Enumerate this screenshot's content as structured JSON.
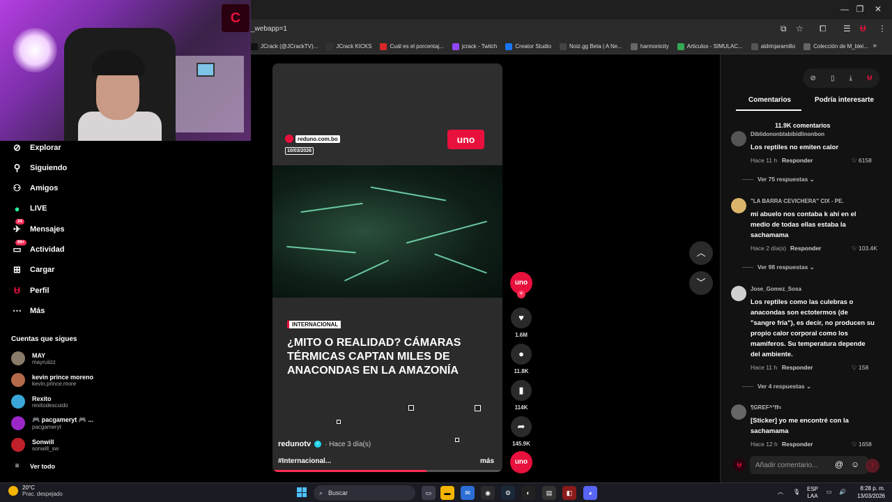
{
  "browser": {
    "url": "_webapp=1",
    "bookmarks": [
      {
        "label": "JCrack (@JCrackTV)...",
        "icon": "x-logo",
        "color": "#111111"
      },
      {
        "label": "JCrack KICKS",
        "icon": "j-logo",
        "color": "#333333"
      },
      {
        "label": "Cuál es el porcentaj...",
        "icon": "s-logo",
        "color": "#d62828"
      },
      {
        "label": "jcrack - Twitch",
        "icon": "twitch-logo",
        "color": "#9146ff"
      },
      {
        "label": "Creator Studio",
        "icon": "facebook-logo",
        "color": "#1877f2"
      },
      {
        "label": "Noiz.gg Beta | A Ne...",
        "icon": "noiz-logo",
        "color": "#444444"
      },
      {
        "label": "harmonicity",
        "icon": "harmonicity-logo",
        "color": "#666666"
      },
      {
        "label": "Articulos - SIMULAC...",
        "icon": "drive-logo",
        "color": "#34a853"
      },
      {
        "label": "aldrinjaramillo",
        "icon": "user-logo",
        "color": "#555555"
      },
      {
        "label": "Colección de M_blei...",
        "icon": "doc-logo",
        "color": "#666666"
      }
    ]
  },
  "webcam": {
    "logo_text": "C"
  },
  "sidebar": {
    "items": [
      {
        "label": "Explorar",
        "icon": "compass-icon"
      },
      {
        "label": "Siguiendo",
        "icon": "following-icon"
      },
      {
        "label": "Amigos",
        "icon": "friends-icon"
      },
      {
        "label": "LIVE",
        "icon": "live-icon"
      },
      {
        "label": "Mensajes",
        "icon": "messages-icon",
        "badge": "24"
      },
      {
        "label": "Actividad",
        "icon": "activity-icon",
        "badge": "99+"
      },
      {
        "label": "Cargar",
        "icon": "upload-icon"
      },
      {
        "label": "Perfil",
        "icon": "profile-icon"
      },
      {
        "label": "Más",
        "icon": "more-icon"
      }
    ],
    "following_title": "Cuentas que sigues",
    "accounts": [
      {
        "name": "MAY",
        "handle": "mayruiizz",
        "color": "#8a7a6a"
      },
      {
        "name": "kevin prince moreno",
        "handle": "kevin.prince.more",
        "color": "#b56a4a"
      },
      {
        "name": "Rexito",
        "handle": "rexitodescuido",
        "color": "#3aa7d8"
      },
      {
        "name": "🎮 pacgameryt 🎮 ...",
        "handle": "pacgameryt",
        "color": "#9b27c8"
      },
      {
        "name": "Sonwill",
        "handle": "sonwill_sw",
        "color": "#c0202a"
      }
    ],
    "see_all": "Ver todo"
  },
  "video": {
    "source_site": "reduno.com.bo",
    "date": "10/03/2026",
    "brand": "uno",
    "brand_small": "red",
    "tag": "INTERNACIONAL",
    "headline": "¿MITO O REALIDAD? CÁMARAS TÉRMICAS CAPTAN MILES DE ANACONDAS EN LA AMAZONÍA",
    "author": "redunotv",
    "time": "· Hace 3 día(s)",
    "description": "#Internacional...",
    "more_label": "más",
    "progress": 0.67
  },
  "actions": {
    "avatar_text": "uno",
    "likes": "1.6M",
    "comments": "11.8K",
    "saves": "114K",
    "shares": "145.9K"
  },
  "panel": {
    "tabs": [
      "Comentarios",
      "Podría interesarte"
    ],
    "comment_count": "11.9K comentarios",
    "comments": [
      {
        "user": "Diblidononblabibidlinonbon",
        "text": "Los reptiles no emiten calor",
        "time": "Hace 11 h",
        "reply": "Responder",
        "likes": "6158",
        "replies": "Ver 75 respuestas",
        "avatar_color": "#555555"
      },
      {
        "user": "\"LA BARRA CEVICHERA\" CIX - PE.",
        "text": "mi abuelo nos contaba k ahí en el medio de todas ellas estaba la sachamama",
        "time": "Hace 2 día(s)",
        "reply": "Responder",
        "likes": "103.4K",
        "replies": "Ver 98 respuestas",
        "avatar_color": "#d9b46a"
      },
      {
        "user": "Jose_Gomez_Sosa",
        "text": "Los reptiles como las culebras o anacondas son ectotermos (de \"sangre fría\"), es decir, no producen su propio calor corporal como los mamíferos. Su temperatura depende del ambiente.",
        "time": "Hace 11 h",
        "reply": "Responder",
        "likes": "158",
        "replies": "Ver 4 respuestas",
        "avatar_color": "#cfcfcf"
      },
      {
        "user": "¶GREF^°ff≈",
        "text": "[Sticker] yo me encontré con la sachamama",
        "time": "Hace 12 h",
        "reply": "Responder",
        "likes": "1658",
        "replies": "",
        "avatar_color": "#666666"
      }
    ],
    "input_placeholder": "Añadir comentario..."
  },
  "taskbar": {
    "temperature": "20°C",
    "weather": "Prac. despejado",
    "search_placeholder": "Buscar",
    "lang1": "ESP",
    "lang2": "LAA",
    "time": "8:28 p. m.",
    "date": "13/03/2026"
  }
}
